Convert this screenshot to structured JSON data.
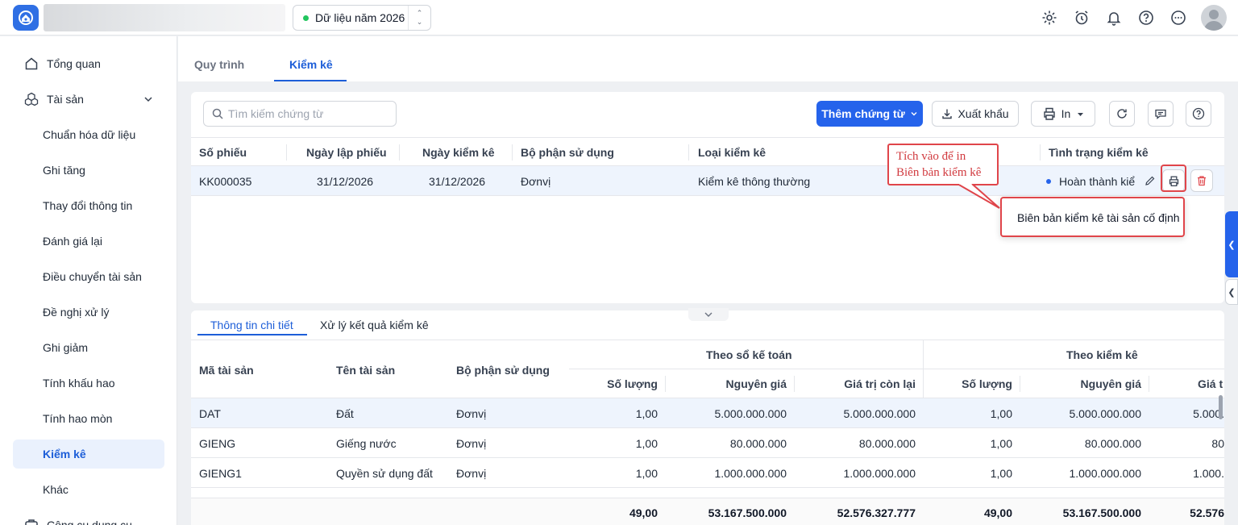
{
  "header": {
    "year_label": "Dữ liệu năm 2026",
    "icons": [
      "gear-icon",
      "alarm-icon",
      "bell-icon",
      "help-icon",
      "more-icon",
      "avatar"
    ]
  },
  "sidebar": {
    "items": [
      {
        "label": "Tổng quan",
        "icon": "home-icon"
      },
      {
        "label": "Tài sản",
        "icon": "assets-icon"
      },
      {
        "label": "Chuẩn hóa dữ liệu"
      },
      {
        "label": "Ghi tăng"
      },
      {
        "label": "Thay đổi thông tin"
      },
      {
        "label": "Đánh giá lại"
      },
      {
        "label": "Điều chuyển tài sản"
      },
      {
        "label": "Đề nghị xử lý"
      },
      {
        "label": "Ghi giảm"
      },
      {
        "label": "Tính khấu hao"
      },
      {
        "label": "Tính hao mòn"
      },
      {
        "label": "Kiểm kê",
        "active": true
      },
      {
        "label": "Khác"
      },
      {
        "label": "Công cụ dụng cụ"
      }
    ]
  },
  "tabs": {
    "process": "Quy trình",
    "inventory": "Kiểm kê"
  },
  "toolbar": {
    "search_placeholder": "Tìm kiếm chứng từ",
    "add_label": "Thêm chứng từ",
    "export_label": "Xuất khẩu",
    "print_label": "In"
  },
  "voucher_table": {
    "columns": [
      "Số phiếu",
      "Ngày lập phiếu",
      "Ngày kiểm kê",
      "Bộ phận sử dụng",
      "Loại kiểm kê",
      "Tình trạng kiểm kê"
    ],
    "rows": [
      {
        "so_phieu": "KK000035",
        "ngay_lap": "31/12/2026",
        "ngay_kiem_ke": "31/12/2026",
        "bo_phan": "Đơnvị",
        "loai": "Kiểm kê thông thường",
        "tinh_trang": "Hoàn thành kiể"
      }
    ]
  },
  "callout": {
    "line1": "Tích vào để in",
    "line2": "Biên bản kiểm kê"
  },
  "print_menu": {
    "item": "Biên bản kiểm kê tài sản cố định"
  },
  "detail_tabs": {
    "detail": "Thông tin chi tiết",
    "result": "Xử lý kết quả kiểm kê"
  },
  "asset_table": {
    "col_code": "Mã tài sản",
    "col_name": "Tên tài sản",
    "col_dept": "Bộ phận sử dụng",
    "group_book": "Theo sổ kế toán",
    "group_count": "Theo kiểm kê",
    "col_qty": "Số lượng",
    "col_cost": "Nguyên giá",
    "col_remaining": "Giá trị còn lại",
    "col_value_cut": "Giá t",
    "rows": [
      {
        "code": "DAT",
        "name": "Đất",
        "dept": "Đơnvị",
        "qty_book": "1,00",
        "cost_book": "5.000.000.000",
        "remain_book": "5.000.000.000",
        "qty_count": "1,00",
        "cost_count": "5.000.000.000",
        "remain_count": "5.000."
      },
      {
        "code": "GIENG",
        "name": "Giếng nước",
        "dept": "Đơnvị",
        "qty_book": "1,00",
        "cost_book": "80.000.000",
        "remain_book": "80.000.000",
        "qty_count": "1,00",
        "cost_count": "80.000.000",
        "remain_count": "80"
      },
      {
        "code": "GIENG1",
        "name": "Quyền sử dụng đất",
        "dept": "Đơnvị",
        "qty_book": "1,00",
        "cost_book": "1.000.000.000",
        "remain_book": "1.000.000.000",
        "qty_count": "1,00",
        "cost_count": "1.000.000.000",
        "remain_count": "1.000."
      }
    ],
    "totals": {
      "qty_book": "49,00",
      "cost_book": "53.167.500.000",
      "remain_book": "52.576.327.777",
      "qty_count": "49,00",
      "cost_count": "53.167.500.000",
      "remain_count": "52.576"
    }
  },
  "colors": {
    "accent": "#2563eb",
    "callout": "#e0454a",
    "selected_row": "#eef4fd"
  }
}
